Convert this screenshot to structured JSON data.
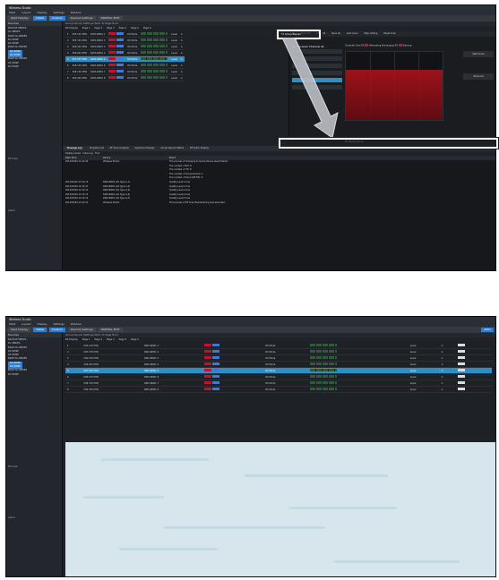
{
  "app": {
    "title": "Wireless Studio",
    "menu": [
      "Start",
      "Layout",
      "Display",
      "Settings",
      "Window"
    ],
    "toolbar": [
      "Start Display",
      "Detail",
      "Custom",
      "Devices Settings",
      "NORMAL EDIT"
    ],
    "toolbar_right": "Aktiv"
  },
  "sidebar": {
    "header": "Devices",
    "tree": [
      "BACKUP SERIES",
      "DL SERIES",
      "BASE DL-SERIES",
      "RX ZONE",
      "RX ZONE",
      "BASE DL-SERIES",
      "RX ZONE",
      "RX ZONE",
      "BASE DL-SERIES",
      "RX ZONE",
      "RX ZONE"
    ],
    "selected": [
      "RX ZONE",
      "RX ZONE"
    ],
    "sections": [
      "RF Load",
      "Alarm"
    ]
  },
  "main": {
    "breadcrumb": "Group Device Settings   Work  Tx Page Hold",
    "page_tabs": [
      "RX Display",
      "Page 1",
      "Page 2",
      "Page 3",
      "Page 4",
      "Page 5",
      "Page 6"
    ],
    "rows": [
      {
        "num": "1",
        "freq": "505.125 MHz",
        "name": "DWX-RM01 1",
        "type": "RX Mode",
        "level": "Level",
        "ch": "A"
      },
      {
        "num": "2",
        "freq": "505.725 MHz",
        "name": "DWX-RM01 2",
        "type": "RX Mode",
        "level": "Level",
        "ch": "A"
      },
      {
        "num": "3",
        "freq": "506.325 MHz",
        "name": "DWX-RM01 3",
        "type": "RX Mode",
        "level": "Level",
        "ch": "A"
      },
      {
        "num": "4",
        "freq": "506.925 MHz",
        "name": "DWX-RM01 4",
        "type": "RX Mode",
        "level": "Level",
        "ch": "A"
      },
      {
        "num": "5",
        "freq": "507.525 MHz",
        "name": "DWX-RM01 5",
        "type": "RX Mode",
        "level": "Level",
        "ch": "A"
      },
      {
        "num": "6",
        "freq": "508.125 MHz",
        "name": "DWX-RM01 6",
        "type": "RX Mode",
        "level": "Level",
        "ch": "A"
      },
      {
        "num": "7",
        "freq": "508.725 MHz",
        "name": "DWX-RM01 7",
        "type": "RX Mode",
        "level": "Level",
        "ch": "A"
      },
      {
        "num": "8",
        "freq": "509.325 MHz",
        "name": "DWX-RM01 8",
        "type": "RX Mode",
        "level": "Level",
        "ch": "A"
      }
    ],
    "highlight_row": 4
  },
  "right_panel": {
    "tabs": [
      "Tx",
      "Scan Mo",
      "Scan All",
      "Save All",
      "Auto Scan",
      "Stop Adding",
      "Reset Scan"
    ],
    "header": "Rx: Receiver Channel 4A",
    "legend": [
      "Currently Tune RX",
      "Alternating",
      "Exchanging RX",
      "Warning"
    ],
    "side_buttons": [
      "Start Scan",
      "Show All"
    ],
    "footer": "RF Display  Pause",
    "callout_top": "Tx Group Rescan",
    "callout_bottom": ""
  },
  "bottom": {
    "tabs": [
      "Message Log",
      "Property List",
      "RF Scan Analysis",
      "Spectrum Display",
      "Group Device Status",
      "RF Quick Display"
    ],
    "active_tab": "Message Log",
    "tools": [
      "Display Levels",
      "Clear Log",
      "Find"
    ],
    "columns": [
      "Date Time",
      "Device",
      "Event"
    ],
    "rows": [
      {
        "time": "2014/03/04 12:12:43",
        "device": "Wireless Studio",
        "event": "The process of changing to Group Device was finished."
      },
      {
        "time": "",
        "device": "",
        "event": "The number of RX: 8"
      },
      {
        "time": "",
        "device": "",
        "event": "The number of TX: 8"
      },
      {
        "time": "",
        "device": "",
        "event": "The number of Group Device: 1"
      },
      {
        "time": "",
        "device": "",
        "event": "The number of band (RF-TIE): 4"
      },
      {
        "time": "2014/03/04 12:12:13",
        "device": "DWX-RM01 (Rx Type A-1)",
        "event": "Quality Level 1 line"
      },
      {
        "time": "2014/03/04 12:12:13",
        "device": "DWX-RM01 (Rx Type A-2)",
        "event": "Quality Level 2 line"
      },
      {
        "time": "2014/03/04 12:12:13",
        "device": "DWX-RM01 (Rx Type A-3)",
        "event": "Quality Level 3 line"
      },
      {
        "time": "2014/03/04 12:12:13",
        "device": "DWX-RM01 (Rx Type A-4)",
        "event": "Quality Level 4 line"
      },
      {
        "time": "2014/03/04 12:12:13",
        "device": "DWX-RM01 (Rx Type A-5)",
        "event": "Quality Level 5 line"
      },
      {
        "time": "2014/03/04 12:12:13",
        "device": "Wireless Studio",
        "event": "The process of RF Scan Rescheduling was executed."
      }
    ]
  }
}
